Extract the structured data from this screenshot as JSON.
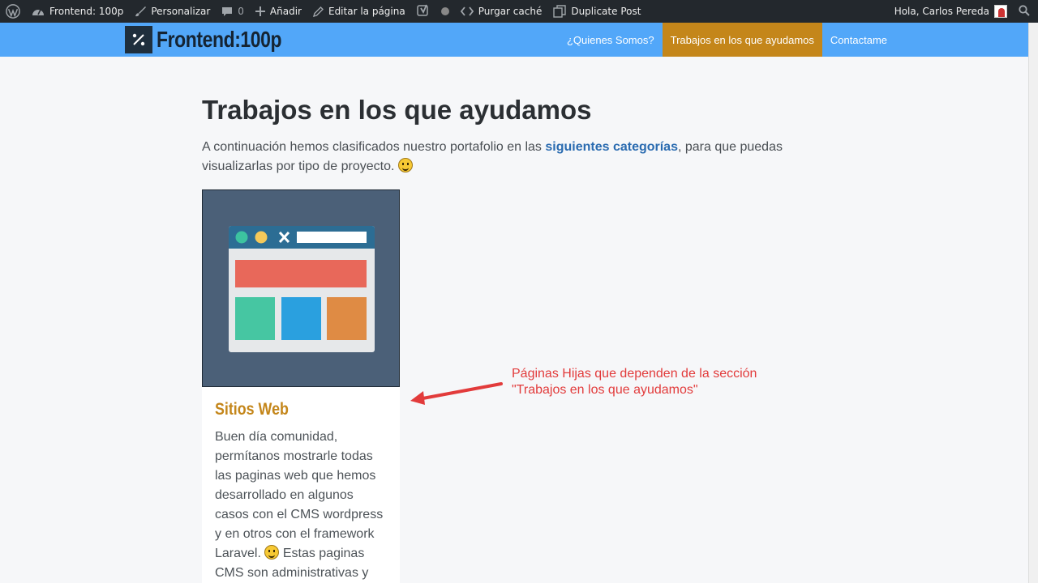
{
  "adminbar": {
    "site_name": "Frontend: 100p",
    "customize": "Personalizar",
    "comments_count": "0",
    "add_new": "Añadir",
    "edit_page": "Editar la página",
    "purge_cache": "Purgar caché",
    "duplicate_post": "Duplicate Post",
    "greeting": "Hola, Carlos Pereda"
  },
  "header": {
    "logo_mark": "⁰⁄₀",
    "logo_text": "Frontend:100p",
    "nav": [
      {
        "label": "¿Quienes Somos?"
      },
      {
        "label": "Trabajos en los que ayudamos"
      },
      {
        "label": "Contactame"
      }
    ]
  },
  "page": {
    "title": "Trabajos en los que ayudamos",
    "intro_before": "A continuación hemos clasificados nuestro portafolio en las ",
    "intro_link": "siguientes categorías",
    "intro_after": ", para que puedas visualizarlas por tipo de proyecto. "
  },
  "card": {
    "title": "Sitios Web",
    "text_part1": "Buen día comunidad, permítanos mostrarle todas las paginas web que hemos desarrollado en algunos casos con el CMS wordpress y en otros con el framework Laravel. ",
    "text_part2": " Estas paginas CMS son administrativas y"
  },
  "annotation": {
    "line1": "Páginas Hijas que dependen de la sección",
    "line2": "\"Trabajos en los que ayudamos\""
  },
  "colors": {
    "adminbar_bg": "#23282d",
    "header_bg": "#52a7f9",
    "nav_active_bg": "#c4861a",
    "link": "#2a6bb0",
    "card_title": "#c4861a",
    "annotation": "#e23b3b"
  }
}
